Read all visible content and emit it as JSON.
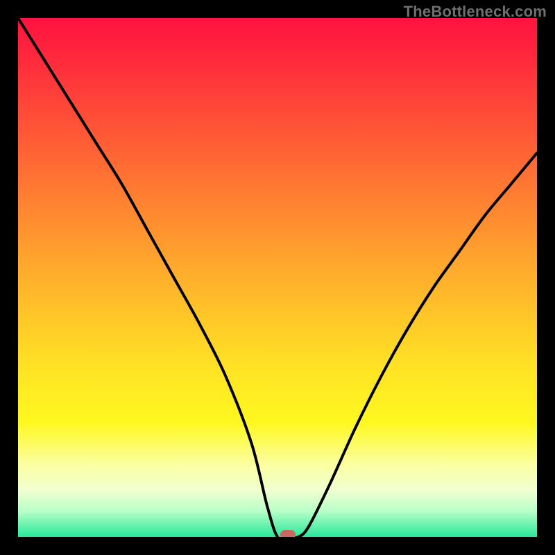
{
  "watermark": "TheBottleneck.com",
  "chart_data": {
    "type": "line",
    "title": "",
    "xlabel": "",
    "ylabel": "",
    "xlim": [
      0,
      100
    ],
    "ylim": [
      0,
      100
    ],
    "x": [
      0,
      5,
      10,
      15,
      20,
      25,
      30,
      35,
      40,
      45,
      48,
      50,
      52,
      54,
      56,
      60,
      65,
      70,
      75,
      80,
      85,
      90,
      95,
      100
    ],
    "values": [
      100,
      92,
      84,
      76,
      68,
      59,
      50,
      41,
      31,
      18,
      6,
      0,
      0,
      0,
      2,
      10,
      21,
      31,
      40,
      48,
      55,
      62,
      68,
      74
    ],
    "marker": {
      "x": 52,
      "y": 0
    },
    "annotations": []
  },
  "colors": {
    "curve": "#000000",
    "marker": "#c6695f",
    "background_border": "#000000"
  }
}
